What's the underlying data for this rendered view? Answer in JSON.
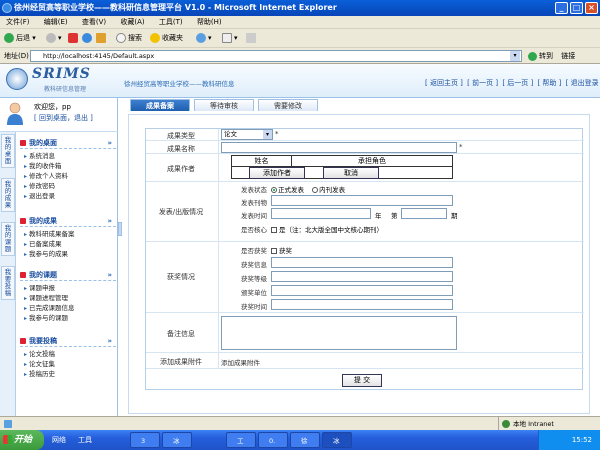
{
  "browser": {
    "title": "徐州经贸高等职业学校——教科研信息管理平台 V1.0 - Microsoft Internet Explorer",
    "menu": [
      "文件(F)",
      "编辑(E)",
      "查看(V)",
      "收藏(A)",
      "工具(T)",
      "帮助(H)"
    ],
    "toolbar": {
      "back": "后退",
      "search": "搜索",
      "favorites": "收藏夹"
    },
    "address_label": "地址(D)",
    "address": "http://localhost:4145/Default.aspx",
    "go": "转到",
    "links": "链接"
  },
  "header": {
    "logo": "SRIMS",
    "logo_sub": "教科研信息管理",
    "school": "徐州经贸高等职业学校——教科研信息",
    "nav": [
      "[ 返回主页 ]",
      "[ 前一页 ]",
      "[ 后一页 ]",
      "[ 帮助 ]",
      "[ 退出登录 ]"
    ]
  },
  "user": {
    "welcome": "欢迎您，pp",
    "links": "[ 回到桌面，退出 ]"
  },
  "vtabs": [
    "我的桌面",
    "我的成果",
    "我的课题",
    "我要投稿"
  ],
  "menu_groups": [
    {
      "title": "我的桌面",
      "items": [
        "系统消息",
        "我的收件箱",
        "修改个人资料",
        "修改密码",
        "退出登录"
      ]
    },
    {
      "title": "我的成果",
      "items": [
        "教科研成果备案",
        "已备案成果",
        "我参与的成果"
      ]
    },
    {
      "title": "我的课题",
      "items": [
        "课题申报",
        "课题进程管理",
        "已完成课题信息",
        "我参与的课题"
      ]
    },
    {
      "title": "我要投稿",
      "items": [
        "论文投稿",
        "论文征集",
        "投稿历史"
      ]
    }
  ],
  "tabs": [
    "成果备案",
    "等待审核",
    "需要修改"
  ],
  "form": {
    "type_label": "成果类型",
    "type_value": "论文",
    "name_label": "成果名称",
    "author_label": "成果作者",
    "author_cols": [
      "姓名",
      "承担角色"
    ],
    "add_author": "添加作者",
    "cancel": "取消",
    "pub_label": "发表/出版情况",
    "pub_status": "发表状态",
    "pub_opts": [
      "正式发表",
      "内刊发表"
    ],
    "pub_journal": "发表刊物",
    "pub_time": "发表时间",
    "year": "年",
    "issue_no": "第",
    "issue": "期",
    "core_label": "是否核心",
    "core_check": "是（注：北大版全国中文核心期刊）",
    "award_label": "获奖情况",
    "award_q": "是否获奖",
    "award_check": "获奖",
    "award_info": "获奖信息",
    "award_level": "获奖等级",
    "award_unit": "颁奖单位",
    "award_time": "获奖时间",
    "note_label": "备注信息",
    "attach_label": "添加成果附件",
    "attach_value": "添加成果附件",
    "submit": "提 交"
  },
  "status": {
    "zone": "本地 Intranet"
  },
  "taskbar": {
    "start": "开始",
    "quick": [
      "网络",
      "工具"
    ],
    "tasks": [
      "3",
      "冰",
      "工",
      "0.",
      "徐",
      "冰"
    ],
    "time": "15:52"
  }
}
